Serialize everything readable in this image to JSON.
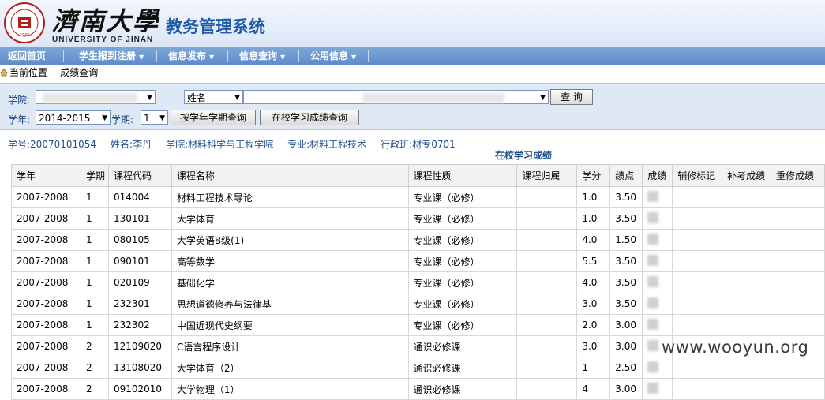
{
  "header": {
    "university_cn": "濟南大學",
    "university_en": "UNIVERSITY OF JINAN",
    "system_title": "教务管理系统",
    "seal_icon": "university-seal-icon"
  },
  "nav": {
    "items": [
      {
        "label": "返回首页",
        "dropdown": false
      },
      {
        "label": "学生报到注册",
        "dropdown": true
      },
      {
        "label": "信息发布",
        "dropdown": true
      },
      {
        "label": "信息查询",
        "dropdown": true
      },
      {
        "label": "公用信息",
        "dropdown": true
      }
    ]
  },
  "breadcrumb": {
    "text": "当前位置 -- 成绩查询"
  },
  "search": {
    "college_label": "学院:",
    "name_select_value": "姓名",
    "query_button": "查 询",
    "year_label": "学年:",
    "year_value": "2014-2015",
    "term_label": "学期:",
    "term_value": "1",
    "btn_term_query": "按学年学期查询",
    "btn_all_query": "在校学习成绩查询"
  },
  "student": {
    "id": "学号:20070101054",
    "name": "姓名:李丹",
    "college": "学院:材料科学与工程学院",
    "major": "专业:材料工程技术",
    "class": "行政班:材专0701"
  },
  "table": {
    "title": "在校学习成绩",
    "headers": [
      "学年",
      "学期",
      "课程代码",
      "课程名称",
      "课程性质",
      "课程归属",
      "学分",
      "绩点",
      "成绩",
      "辅修标记",
      "补考成绩",
      "重修成绩"
    ],
    "rows": [
      [
        "2007-2008",
        "1",
        "014004",
        "材料工程技术导论",
        "专业课（必修）",
        "",
        "1.0",
        "3.50",
        "",
        "",
        "",
        ""
      ],
      [
        "2007-2008",
        "1",
        "130101",
        "大学体育",
        "专业课（必修）",
        "",
        "1.0",
        "3.50",
        "",
        "",
        "",
        ""
      ],
      [
        "2007-2008",
        "1",
        "080105",
        "大学英语B级(1)",
        "专业课（必修）",
        "",
        "4.0",
        "1.50",
        "",
        "",
        "",
        ""
      ],
      [
        "2007-2008",
        "1",
        "090101",
        "高等数学",
        "专业课（必修）",
        "",
        "5.5",
        "3.50",
        "",
        "",
        "",
        ""
      ],
      [
        "2007-2008",
        "1",
        "020109",
        "基础化学",
        "专业课（必修）",
        "",
        "4.0",
        "3.50",
        "",
        "",
        "",
        ""
      ],
      [
        "2007-2008",
        "1",
        "232301",
        "思想道德修养与法律基",
        "专业课（必修）",
        "",
        "3.0",
        "3.50",
        "",
        "",
        "",
        ""
      ],
      [
        "2007-2008",
        "1",
        "232302",
        "中国近现代史纲要",
        "专业课（必修）",
        "",
        "2.0",
        "3.00",
        "",
        "",
        "",
        ""
      ],
      [
        "2007-2008",
        "2",
        "12109020",
        "C语言程序设计",
        "通识必修课",
        "",
        "3.0",
        "3.00",
        "",
        "",
        "",
        ""
      ],
      [
        "2007-2008",
        "2",
        "13108020",
        "大学体育（2）",
        "通识必修课",
        "",
        "1",
        "2.50",
        "",
        "",
        "",
        ""
      ],
      [
        "2007-2008",
        "2",
        "09102010",
        "大学物理（1）",
        "通识必修课",
        "",
        "4",
        "3.00",
        "",
        "",
        "",
        ""
      ]
    ]
  },
  "watermark": "www.wooyun.org"
}
